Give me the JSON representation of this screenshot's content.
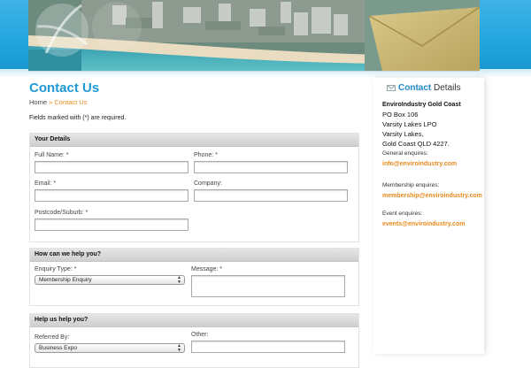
{
  "page": {
    "title": "Contact Us",
    "breadcrumb": {
      "home": "Home",
      "separator": "»",
      "current": "Contact Us"
    },
    "required_note": "Fields marked with (*) are required."
  },
  "form": {
    "your_details": {
      "heading": "Your Details",
      "full_name_label": "Full Name: *",
      "phone_label": "Phone: *",
      "email_label": "Email: *",
      "company_label": "Company:",
      "postcode_label": "Postcode/Suburb: *"
    },
    "help_section": {
      "heading": "How can we help you?",
      "enquiry_type_label": "Enquiry Type: *",
      "enquiry_type_value": "Membership Enquiry",
      "message_label": "Message: *"
    },
    "referral": {
      "heading": "Help us help you?",
      "referred_by_label": "Referred By:",
      "referred_by_value": "Business Expo",
      "other_label": "Other:"
    }
  },
  "sidebar": {
    "title_accent": "Contact",
    "title_rest": "Details",
    "company": "EnviroIndustry Gold Coast",
    "address": [
      "PO Box 106",
      "Varsity Lakes LPO",
      "Varsity Lakes,",
      "Gold Coast QLD 4227."
    ],
    "general_label": "General enquires:",
    "general_email": "info@enviroindustry.com",
    "membership_label": "Membership enquires:",
    "membership_email": "membership@enviroindustry.com",
    "event_label": "Event enquires:",
    "event_email": "events@enviroindustry.com"
  },
  "colors": {
    "accent_blue": "#1e9ad6",
    "link_orange": "#e8891c",
    "header_cyan": "#1ea3dc"
  }
}
